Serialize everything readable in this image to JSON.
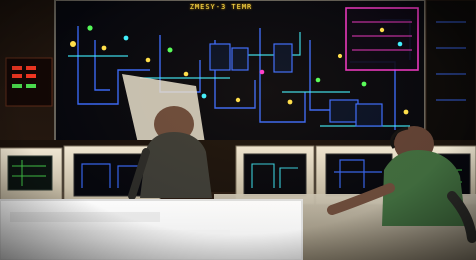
{
  "panel": {
    "title": "ZMESY-3  TEMR"
  },
  "colors": {
    "screen_bg": "#05070d",
    "schematic_blue": "#3b6cff",
    "schematic_cyan": "#3ff0ff",
    "schematic_yellow": "#ffe04a",
    "schematic_magenta": "#ff3bd0",
    "schematic_green": "#55ff5a",
    "console_beige": "#ded6bf",
    "operator_shirt_green": "#3f6a3d"
  }
}
